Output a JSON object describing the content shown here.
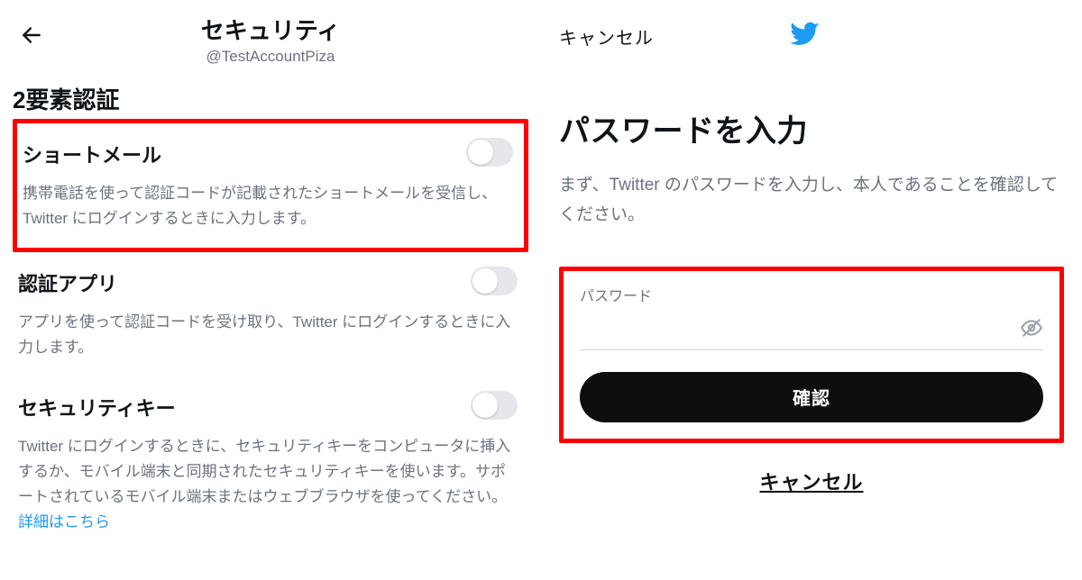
{
  "colors": {
    "accent": "#1d9bf0",
    "danger_box": "#ff0000",
    "muted": "#6b7280",
    "dark": "#0c0e10"
  },
  "left": {
    "title": "セキュリティ",
    "handle": "@TestAccountPiza",
    "section": "2要素認証",
    "items": [
      {
        "title": "ショートメール",
        "desc": "携帯電話を使って認証コードが記載されたショートメールを受信し、Twitter にログインするときに入力します。",
        "toggle": false,
        "highlighted": true
      },
      {
        "title": "認証アプリ",
        "desc": "アプリを使って認証コードを受け取り、Twitter にログインするときに入力します。",
        "toggle": false,
        "highlighted": false
      },
      {
        "title": "セキュリティキー",
        "desc": "Twitter にログインするときに、セキュリティキーをコンピュータに挿入するか、モバイル端末と同期されたセキュリティキーを使います。サポートされているモバイル端末またはウェブブラウザを使ってください。",
        "link": "詳細はこちら",
        "toggle": false,
        "highlighted": false
      }
    ]
  },
  "right": {
    "cancel_top": "キャンセル",
    "title": "パスワードを入力",
    "desc": "まず、Twitter のパスワードを入力し、本人であることを確認してください。",
    "password_label": "パスワード",
    "password_value": "",
    "confirm": "確認",
    "cancel_bottom": "キャンセル"
  }
}
